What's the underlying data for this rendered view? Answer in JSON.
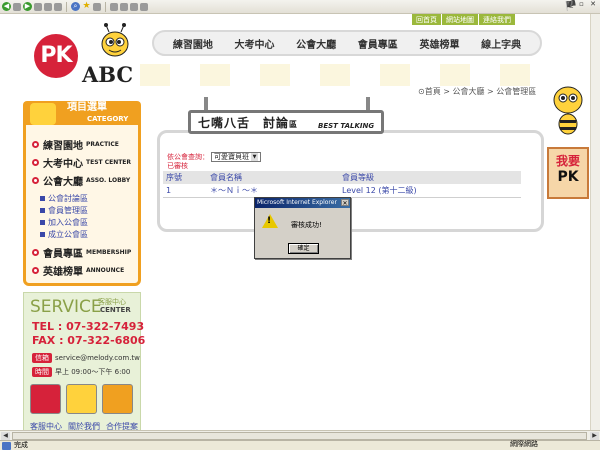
{
  "browser": {
    "status_text": "完成",
    "zone_text": "網際網路"
  },
  "header": {
    "top_links": [
      "回首頁",
      "網站地圖",
      "連絡我們"
    ],
    "logo_pk": "PK",
    "logo_abc": "ABC",
    "nav": [
      "練習園地",
      "大考中心",
      "公會大廳",
      "會員專區",
      "英雄榜單",
      "線上字典"
    ],
    "breadcrumb": "⊙首頁 > 公會大廳 > 公會管理區"
  },
  "sidebar": {
    "category_title": "項目選單",
    "category_en": "CATEGORY",
    "items": [
      {
        "label": "練習園地",
        "en": "PRACTICE"
      },
      {
        "label": "大考中心",
        "en": "TEST CENTER"
      },
      {
        "label": "公會大廳",
        "en": "ASSO. LOBBY"
      },
      {
        "label": "會員專區",
        "en": "MEMBERSHIP"
      },
      {
        "label": "英雄榜單",
        "en": "ANNOUNCE"
      }
    ],
    "sub_items": [
      "公會討論區",
      "會員管理區",
      "加入公會區",
      "成立公會區"
    ]
  },
  "service": {
    "title": "SERVICE",
    "cn": "客服中心",
    "en": "CENTER",
    "tel": "TEL : 07-322-7493",
    "fax": "FAX : 07-322-6806",
    "mail_tag": "信箱",
    "mail": "service@melody.com.tw",
    "time_tag": "時間",
    "time": "早上 09:00～下午 6:00",
    "links": [
      "客服中心",
      "關於我們",
      "合作提案"
    ]
  },
  "right_rail": {
    "pk_line1": "我要",
    "pk_line2": "PK"
  },
  "board": {
    "title": "七嘴八舌　討論",
    "title_suffix": "區",
    "subtitle": "BEST TALKING",
    "filter_label": "依公會查詢：",
    "filter_value": "可愛寶貝班",
    "checked_label": "已審核",
    "columns": [
      "序號",
      "會員名稱",
      "會員等級"
    ],
    "rows": [
      {
        "no": "1",
        "name": "＊～Ｎｉ～＊",
        "level": "Level 12 (第十二級)"
      }
    ]
  },
  "dialog": {
    "title": "Microsoft Internet Explorer",
    "message": "審核成功!",
    "ok_label": "確定"
  }
}
